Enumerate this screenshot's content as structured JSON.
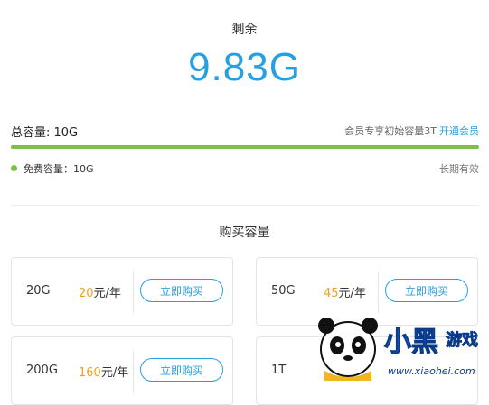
{
  "summary": {
    "remaining_label": "剩余",
    "remaining_value": "9.83G",
    "total_label": "总容量: 10G",
    "member_promo": "会员专享初始容量3T",
    "member_link": "开通会员",
    "used_fraction": 1.0,
    "free_label": "免费容量：10G",
    "validity": "长期有效"
  },
  "purchase": {
    "title": "购买容量",
    "buy_label": "立即购买",
    "plans": [
      {
        "size": "20G",
        "price": "20",
        "unit": "元/年"
      },
      {
        "size": "50G",
        "price": "45",
        "unit": "元/年"
      },
      {
        "size": "200G",
        "price": "160",
        "unit": "元/年"
      },
      {
        "size": "1T",
        "price": "",
        "unit": ""
      }
    ]
  },
  "watermark": {
    "brand": "小黑游戏",
    "url": "www.xiaohei.com"
  },
  "colors": {
    "accent_blue": "#2a9fe0",
    "progress_green": "#7dc143",
    "price_orange": "#f0a020"
  }
}
